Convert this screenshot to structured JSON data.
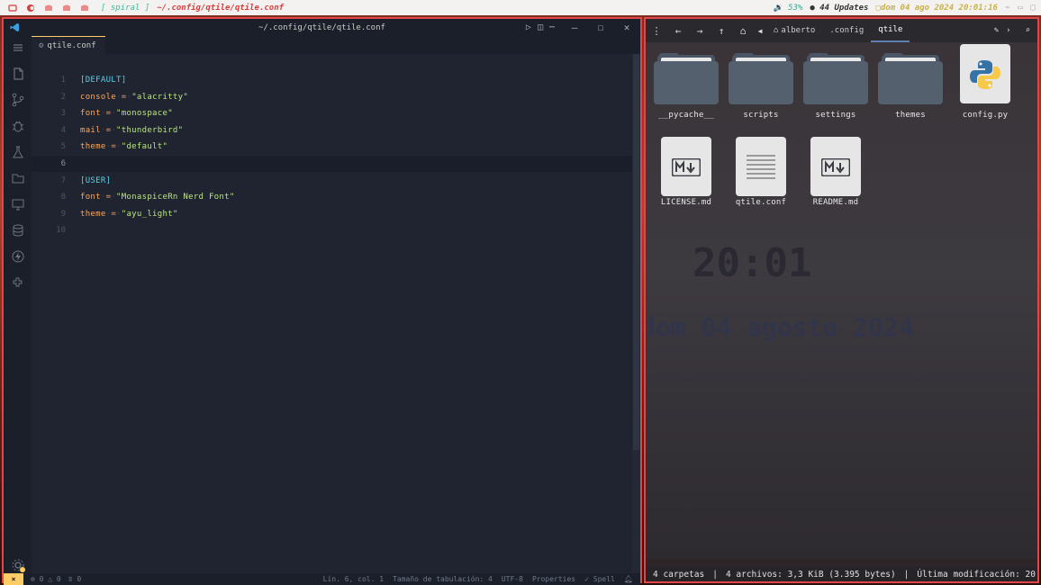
{
  "topbar": {
    "layout": "[ spiral ]",
    "window_title": "~/.config/qtile/qtile.conf",
    "battery": "53%",
    "updates": "44 Updates",
    "clock": "dom 04 ago 2024 20:01:16"
  },
  "vscode": {
    "title": "~/.config/qtile/qtile.conf",
    "tab": "qtile.conf",
    "lines": [
      {
        "n": "1",
        "sec": "[DEFAULT]"
      },
      {
        "n": "2",
        "key": "console",
        "val": "\"alacritty\""
      },
      {
        "n": "3",
        "key": "font",
        "val": "\"monospace\""
      },
      {
        "n": "4",
        "key": "mail",
        "val": "\"thunderbird\""
      },
      {
        "n": "5",
        "key": "theme",
        "val": "\"default\""
      },
      {
        "n": "6"
      },
      {
        "n": "7",
        "sec": "[USER]"
      },
      {
        "n": "8",
        "key": "font",
        "val": "\"MonaspiceRn Nerd Font\""
      },
      {
        "n": "9",
        "key": "theme",
        "val": "\"ayu_light\""
      },
      {
        "n": "10"
      }
    ],
    "status": {
      "errors": "0",
      "warnings": "0",
      "ports": "0",
      "position": "Lín. 6, col. 1",
      "tab_size": "Tamaño de tabulación: 4",
      "encoding": "UTF-8",
      "language": "Properties",
      "spell": "Spell",
      "accounts_badge": "1"
    }
  },
  "files": {
    "breadcrumbs": [
      "alberto",
      ".config",
      "qtile"
    ],
    "items": [
      {
        "name": "__pycache__",
        "type": "folder"
      },
      {
        "name": "scripts",
        "type": "folder"
      },
      {
        "name": "settings",
        "type": "folder"
      },
      {
        "name": "themes",
        "type": "folder"
      },
      {
        "name": "config.py",
        "type": "python"
      },
      {
        "name": "LICENSE.md",
        "type": "markdown"
      },
      {
        "name": "qtile.conf",
        "type": "text"
      },
      {
        "name": "README.md",
        "type": "markdown"
      }
    ],
    "status": {
      "folders": "4 carpetas",
      "files": "4 archivos: 3,3 KiB (3.395 bytes)",
      "modified": "Última modificación: 20..."
    }
  },
  "colors": {
    "accent_red": "#e0464a",
    "editor_bg": "#1f2430",
    "string": "#bae67e",
    "key": "#ffa759",
    "section": "#5ccfe6"
  }
}
